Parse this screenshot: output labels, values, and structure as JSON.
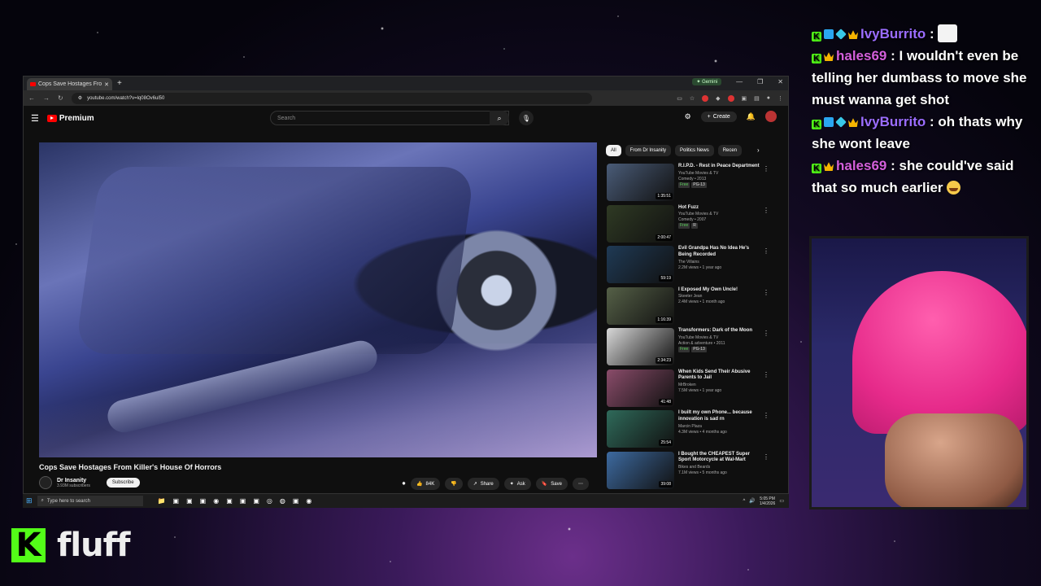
{
  "browser": {
    "tab_title": "Cops Save Hostages From Killer's...",
    "new_tab": "+",
    "gemini_label": "Gemini",
    "url": "youtube.com/watch?v=lq08Ov6ul50"
  },
  "youtube": {
    "logo": "Premium",
    "search_placeholder": "Search",
    "create_label": "Create"
  },
  "video": {
    "title": "Cops Save Hostages From Killer's House Of Horrors",
    "channel_name": "Dr Insanity",
    "subscribers": "3.93M subscribers",
    "subscribe_label": "Subscribe",
    "likes": "84K",
    "share_label": "Share",
    "ask_label": "Ask",
    "save_label": "Save"
  },
  "chips": [
    "All",
    "From Dr Insanity",
    "Politics News",
    "Recen"
  ],
  "recommendations": [
    {
      "title": "R.I.P.D. - Rest in Peace Department",
      "channel": "YouTube Movies & TV",
      "meta": "Comedy • 2013",
      "badges": [
        "Free",
        "PG-13"
      ],
      "duration": "1:35:51",
      "color": "#4a5c78"
    },
    {
      "title": "Hot Fuzz",
      "channel": "YouTube Movies & TV",
      "meta": "Comedy • 2007",
      "badges": [
        "Free",
        "R"
      ],
      "duration": "2:00:47",
      "color": "#2f3a24"
    },
    {
      "title": "Evil Grandpa Has No Idea He's Being Recorded",
      "channel": "The Villains",
      "meta": "2.2M views • 1 year ago",
      "badges": [],
      "duration": "59:19",
      "color": "#1f3a55"
    },
    {
      "title": "I Exposed My Own Uncle!",
      "channel": "Skeeter Jean",
      "meta": "2.4M views • 1 month ago",
      "badges": [],
      "duration": "1:16:39",
      "color": "#556047"
    },
    {
      "title": "Transformers: Dark of the Moon",
      "channel": "YouTube Movies & TV",
      "meta": "Action & adventure • 2011",
      "badges": [
        "Free",
        "PG-13"
      ],
      "duration": "2:34:23",
      "color": "#d8d8d8"
    },
    {
      "title": "When Kids Send Their Abusive Parents to Jail",
      "channel": "MrBroken",
      "meta": "7.5M views • 1 year ago",
      "badges": [],
      "duration": "41:48",
      "color": "#8a4c6a"
    },
    {
      "title": "I built my own Phone... because innovation is sad rn",
      "channel": "Marcin Plaza",
      "meta": "4.3M views • 4 months ago",
      "badges": [],
      "duration": "25:54",
      "color": "#2f6a5a"
    },
    {
      "title": "I Bought the CHEAPEST Super Sport Motorcycle at Wal-Mart",
      "channel": "Bikes and Beards",
      "meta": "7.1M views • 5 months ago",
      "badges": [],
      "duration": "39:08",
      "color": "#3d6aa0"
    }
  ],
  "taskbar": {
    "search_placeholder": "Type here to search",
    "time": "5:05 PM",
    "date": "1/4/2026"
  },
  "chat": [
    {
      "user": "IvyBurrito",
      "badges": [
        "k",
        "b1",
        "b2",
        "crown"
      ],
      "text": "",
      "emote": true
    },
    {
      "user": "hales69",
      "badges": [
        "k",
        "crown"
      ],
      "text": "I wouldn't even be telling her dumbass to move she must wanna get shot"
    },
    {
      "user": "IvyBurrito",
      "badges": [
        "k",
        "b1",
        "b2",
        "crown"
      ],
      "text": "oh thats why she wont leave"
    },
    {
      "user": "hales69",
      "badges": [
        "k",
        "crown"
      ],
      "text": "she could've said that so much earlier",
      "cry": true
    }
  ],
  "streamer": {
    "name": "fluff",
    "platform_logo": "K"
  },
  "colors": {
    "kick_green": "#53fc18",
    "yt_red": "#ff0000",
    "beanie_pink": "#e62a8a"
  }
}
